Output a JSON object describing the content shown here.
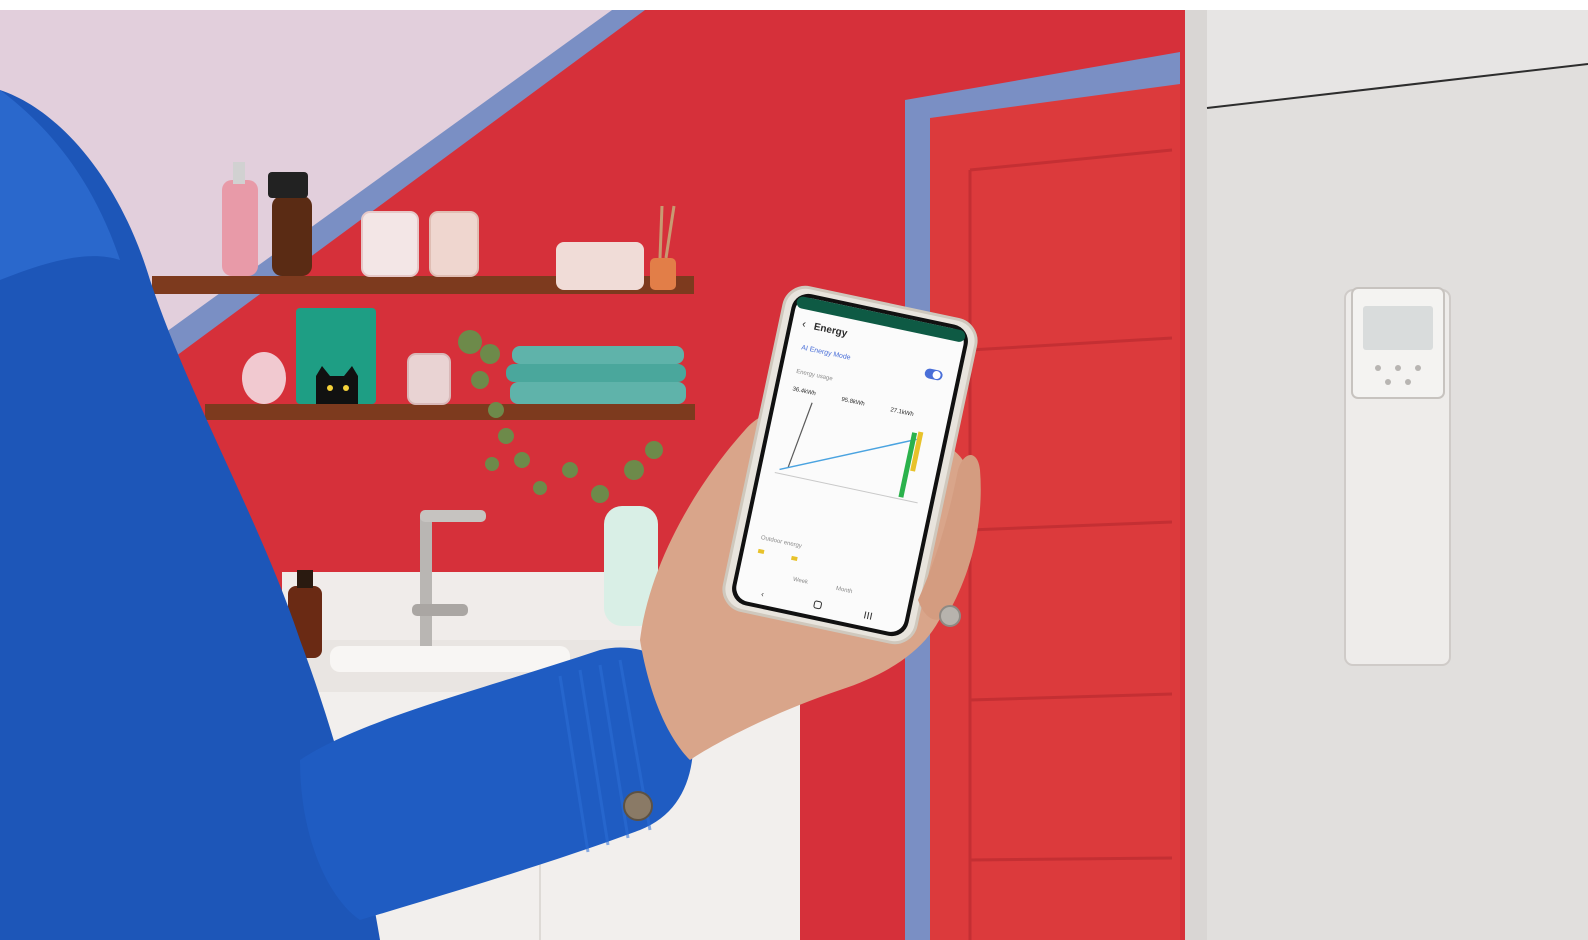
{
  "phone_app": {
    "screen_title": "Energy",
    "mode_label": "AI Energy Mode",
    "chart_section_label": "Energy usage",
    "stat_values": [
      "36.4kWh",
      "95.8kWh",
      "27.1kWh"
    ],
    "bottom_section_label": "Outdoor energy",
    "bottom_tabs": [
      "Week",
      "Month"
    ]
  },
  "colors": {
    "wall_red": "#d6303a",
    "door_red": "#dc3a3c",
    "trim_blue": "#7a8fc4",
    "jacket_blue": "#1d56b8",
    "cabinet_white": "#e7e5e4",
    "phone_body": "#e8e4dd",
    "screen_bg": "#fbfbfb",
    "app_accent_blue": "#4a6fd8",
    "app_accent_green": "#2bb24c",
    "app_accent_yellow": "#e8c22a"
  }
}
